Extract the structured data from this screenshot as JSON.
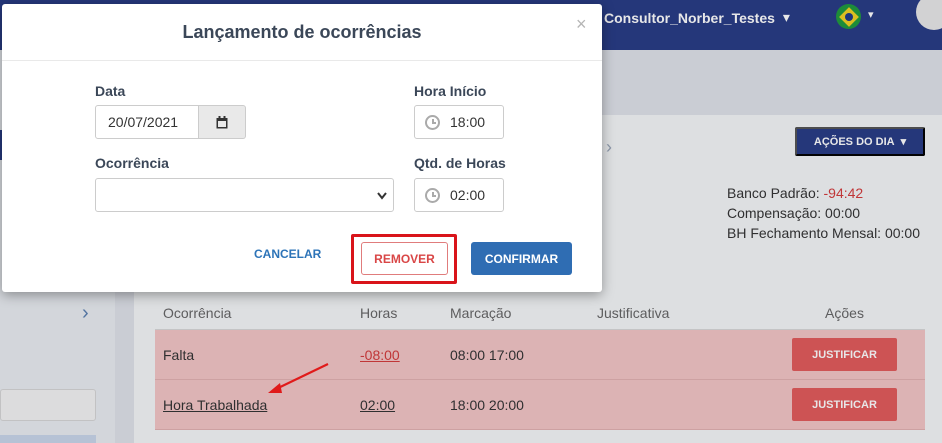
{
  "topbar": {
    "username": "Consultor_Norber_Testes",
    "user_caret": "▾",
    "lang_caret": "▾"
  },
  "page": {
    "actions_button": "AÇÕES DO DIA",
    "actions_caret": "▾",
    "bank": {
      "standard_label": "Banco Padrão:",
      "standard_value": "-94:42",
      "compensation": "Compensação: 00:00",
      "monthly": "BH Fechamento Mensal: 00:00"
    },
    "table": {
      "headers": [
        "Ocorrência",
        "Horas",
        "Marcação",
        "Justificativa",
        "Ações"
      ],
      "rows": [
        {
          "occurrence": "Falta",
          "hours": "-08:00",
          "marks": "08:00  17:00",
          "justification": "",
          "action": "JUSTIFICAR"
        },
        {
          "occurrence": "Hora Trabalhada",
          "hours": "02:00",
          "marks": "18:00  20:00",
          "justification": "",
          "action": "JUSTIFICAR"
        }
      ]
    }
  },
  "modal": {
    "title": "Lançamento de ocorrências",
    "close": "×",
    "date_label": "Data",
    "date_value": "20/07/2021",
    "start_label": "Hora Início",
    "start_value": "18:00",
    "occurrence_label": "Ocorrência",
    "occurrence_value": "",
    "qty_label": "Qtd. de Horas",
    "qty_value": "02:00",
    "cancel": "CANCELAR",
    "remove": "REMOVER",
    "confirm": "CONFIRMAR"
  },
  "colors": {
    "primary": "#283c85",
    "danger": "#e35b5b",
    "confirm": "#2f6db3",
    "highlight": "#d9141a"
  }
}
